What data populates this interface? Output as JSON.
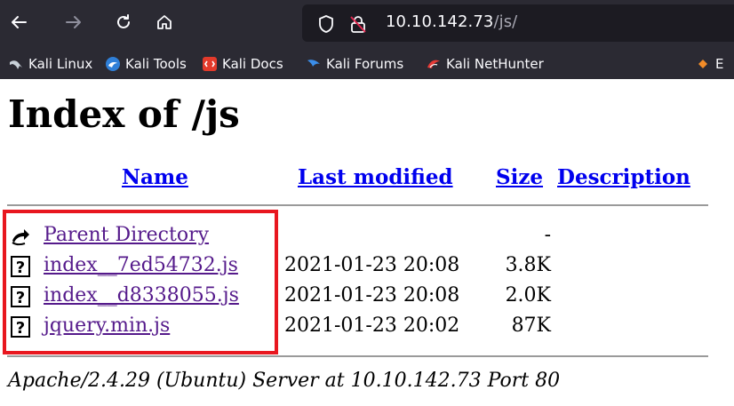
{
  "browser": {
    "url_host": "10.10.142.73",
    "url_path": "/js/",
    "bookmarks": [
      {
        "label": "Kali Linux",
        "icon": "kali-dragon-icon"
      },
      {
        "label": "Kali Tools",
        "icon": "kali-tools-icon"
      },
      {
        "label": "Kali Docs",
        "icon": "kali-docs-icon"
      },
      {
        "label": "Kali Forums",
        "icon": "kali-forums-icon"
      },
      {
        "label": "Kali NetHunter",
        "icon": "kali-nethunter-icon"
      },
      {
        "label": "E",
        "icon": "exploit-db-icon"
      }
    ]
  },
  "page": {
    "title": "Index of /js",
    "columns": {
      "name": "Name",
      "last_modified": "Last modified",
      "size": "Size",
      "description": "Description"
    },
    "rows": [
      {
        "name": "Parent Directory",
        "date": "",
        "size": "-",
        "icon": "back-arrow-icon"
      },
      {
        "name": "index__7ed54732.js",
        "date": "2021-01-23 20:08",
        "size": "3.8K",
        "icon": "unknown-file-icon"
      },
      {
        "name": "index__d8338055.js",
        "date": "2021-01-23 20:08",
        "size": "2.0K",
        "icon": "unknown-file-icon"
      },
      {
        "name": "jquery.min.js",
        "date": "2021-01-23 20:02",
        "size": "87K",
        "icon": "unknown-file-icon"
      }
    ],
    "footer": "Apache/2.4.29 (Ubuntu) Server at 10.10.142.73 Port 80",
    "highlight_color": "#e8171f",
    "link_color": "#0000ee",
    "visited_color": "#551a8b"
  }
}
